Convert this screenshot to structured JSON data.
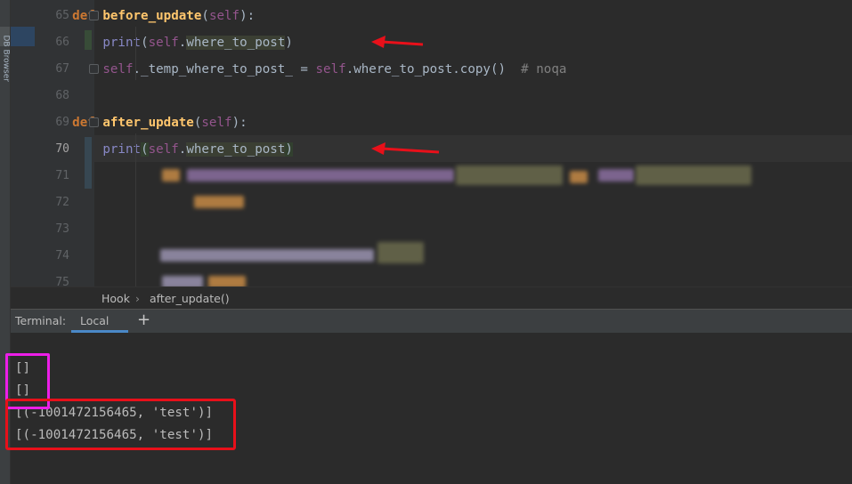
{
  "sidebar": {
    "db_browser_label": "DB Browser"
  },
  "editor": {
    "lines": [
      {
        "num": "65",
        "indent": "    ",
        "tokens": [
          [
            "kw",
            "def "
          ],
          [
            "fn",
            "before_update"
          ],
          [
            "p",
            "("
          ],
          [
            "self",
            "self"
          ],
          [
            "p",
            "):"
          ]
        ]
      },
      {
        "num": "66",
        "indent": "        ",
        "tokens": [
          [
            "bi",
            "print"
          ],
          [
            "p",
            "("
          ],
          [
            "self",
            "self"
          ],
          [
            "p",
            "."
          ],
          [
            "hl",
            "where_to_post"
          ],
          [
            "p",
            ")"
          ]
        ]
      },
      {
        "num": "67",
        "indent": "        ",
        "tokens": [
          [
            "self",
            "self"
          ],
          [
            "p",
            "._temp_where_to_post_ = "
          ],
          [
            "self",
            "self"
          ],
          [
            "p",
            ".where_to_post.copy()  "
          ],
          [
            "cm",
            "# noqa"
          ]
        ]
      },
      {
        "num": "68",
        "indent": "",
        "tokens": []
      },
      {
        "num": "69",
        "indent": "    ",
        "tokens": [
          [
            "kw",
            "def "
          ],
          [
            "fn",
            "after_update"
          ],
          [
            "p",
            "("
          ],
          [
            "self",
            "self"
          ],
          [
            "p",
            "):"
          ]
        ]
      },
      {
        "num": "70",
        "indent": "        ",
        "tokens": [
          [
            "bi",
            "print"
          ],
          [
            "hlc",
            "("
          ],
          [
            "self",
            "self"
          ],
          [
            "p",
            "."
          ],
          [
            "hl",
            "where_to_post"
          ],
          [
            "hlc",
            ")"
          ]
        ]
      },
      {
        "num": "71",
        "indent": "",
        "tokens": []
      },
      {
        "num": "72",
        "indent": "",
        "tokens": []
      },
      {
        "num": "73",
        "indent": "",
        "tokens": []
      },
      {
        "num": "74",
        "indent": "",
        "tokens": []
      },
      {
        "num": "75",
        "indent": "",
        "tokens": []
      }
    ],
    "current_line": "70"
  },
  "breadcrumb": {
    "class_name": "Hook",
    "separator": "›",
    "function_name": "after_update()"
  },
  "terminal": {
    "label": "Terminal:",
    "tab": "Local",
    "add_tab": "+",
    "output": [
      "[]",
      "[]",
      "[(-1001472156465, 'test')]",
      "[(-1001472156465, 'test')]"
    ]
  },
  "colors": {
    "keyword": "#cc7832",
    "function": "#ffc66d",
    "self": "#94558d",
    "builtin": "#8888c6",
    "comment": "#808080",
    "annotation_red": "#e8101a",
    "annotation_pink": "#ec1ee8"
  }
}
